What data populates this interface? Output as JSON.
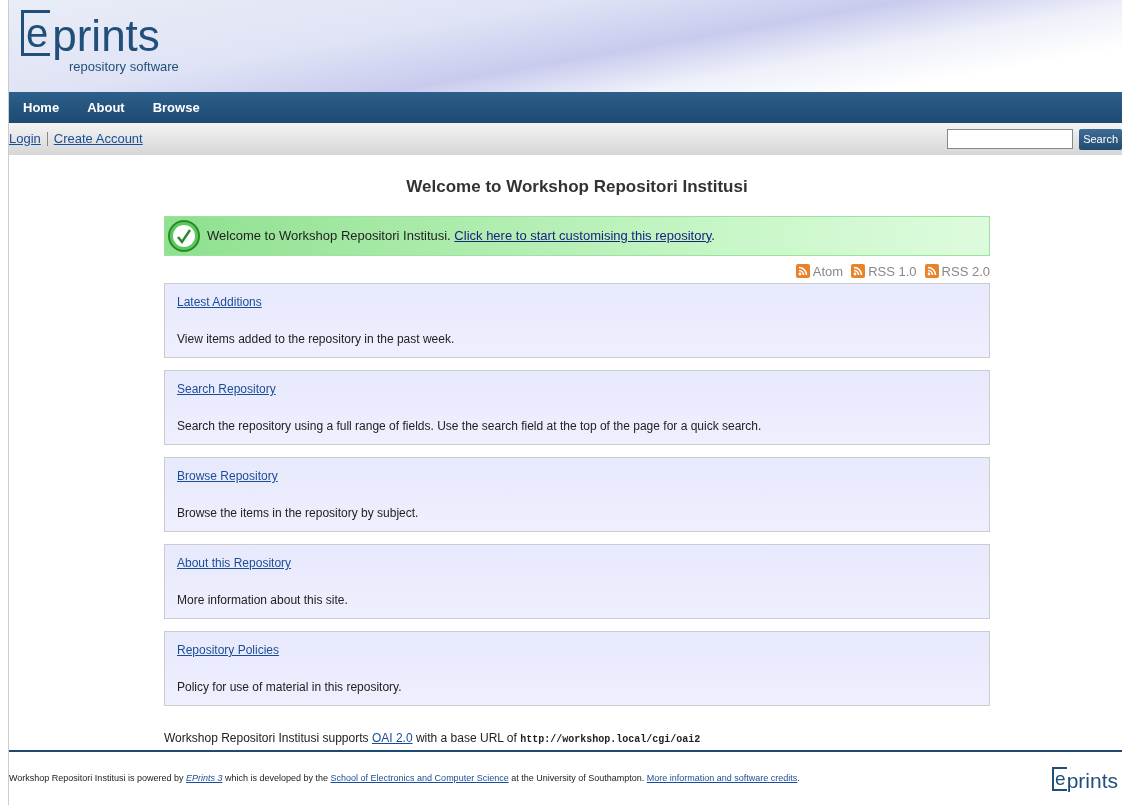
{
  "logo": {
    "mark": "e",
    "word": "prints",
    "tagline": "repository software"
  },
  "nav": [
    {
      "label": "Home"
    },
    {
      "label": "About"
    },
    {
      "label": "Browse"
    }
  ],
  "account_links": [
    {
      "label": "Login"
    },
    {
      "label": "Create Account"
    }
  ],
  "search": {
    "button": "Search"
  },
  "title": "Welcome to Workshop Repositori Institusi",
  "message": {
    "text": "Welcome to Workshop Repositori Institusi.",
    "link": "Click here to start customising this repository",
    "after": "."
  },
  "feeds": [
    {
      "label": "Atom"
    },
    {
      "label": "RSS 1.0"
    },
    {
      "label": "RSS 2.0"
    }
  ],
  "sections": [
    {
      "link": "Latest Additions",
      "text": "View items added to the repository in the past week."
    },
    {
      "link": "Search Repository",
      "text": "Search the repository using a full range of fields. Use the search field at the top of the page for a quick search."
    },
    {
      "link": "Browse Repository",
      "text": "Browse the items in the repository by subject."
    },
    {
      "link": "About this Repository",
      "text": "More information about this site."
    },
    {
      "link": "Repository Policies",
      "text": "Policy for use of material in this repository."
    }
  ],
  "oai_line": [
    {
      "kind": "text",
      "text": "Workshop Repositori Institusi supports"
    },
    {
      "kind": "link",
      "text": "OAI 2.0"
    },
    {
      "kind": "text",
      "text": "with a base URL of"
    },
    {
      "kind": "code",
      "text": "http://workshop.local/cgi/oai2"
    }
  ],
  "footer": {
    "parts": [
      {
        "kind": "text",
        "text": "Workshop Repositori Institusi is powered by"
      },
      {
        "kind": "link",
        "text": "EPrints 3",
        "italic": true
      },
      {
        "kind": "text",
        "text": "which is developed by the"
      },
      {
        "kind": "link",
        "text": "School of Electronics and Computer Science",
        "italic": false
      },
      {
        "kind": "text",
        "text": "at the University of Southampton."
      },
      {
        "kind": "link",
        "text": "More information and software credits",
        "italic": false
      },
      {
        "kind": "text",
        "text": "."
      }
    ],
    "logo": {
      "mark": "e",
      "word": "prints"
    }
  }
}
